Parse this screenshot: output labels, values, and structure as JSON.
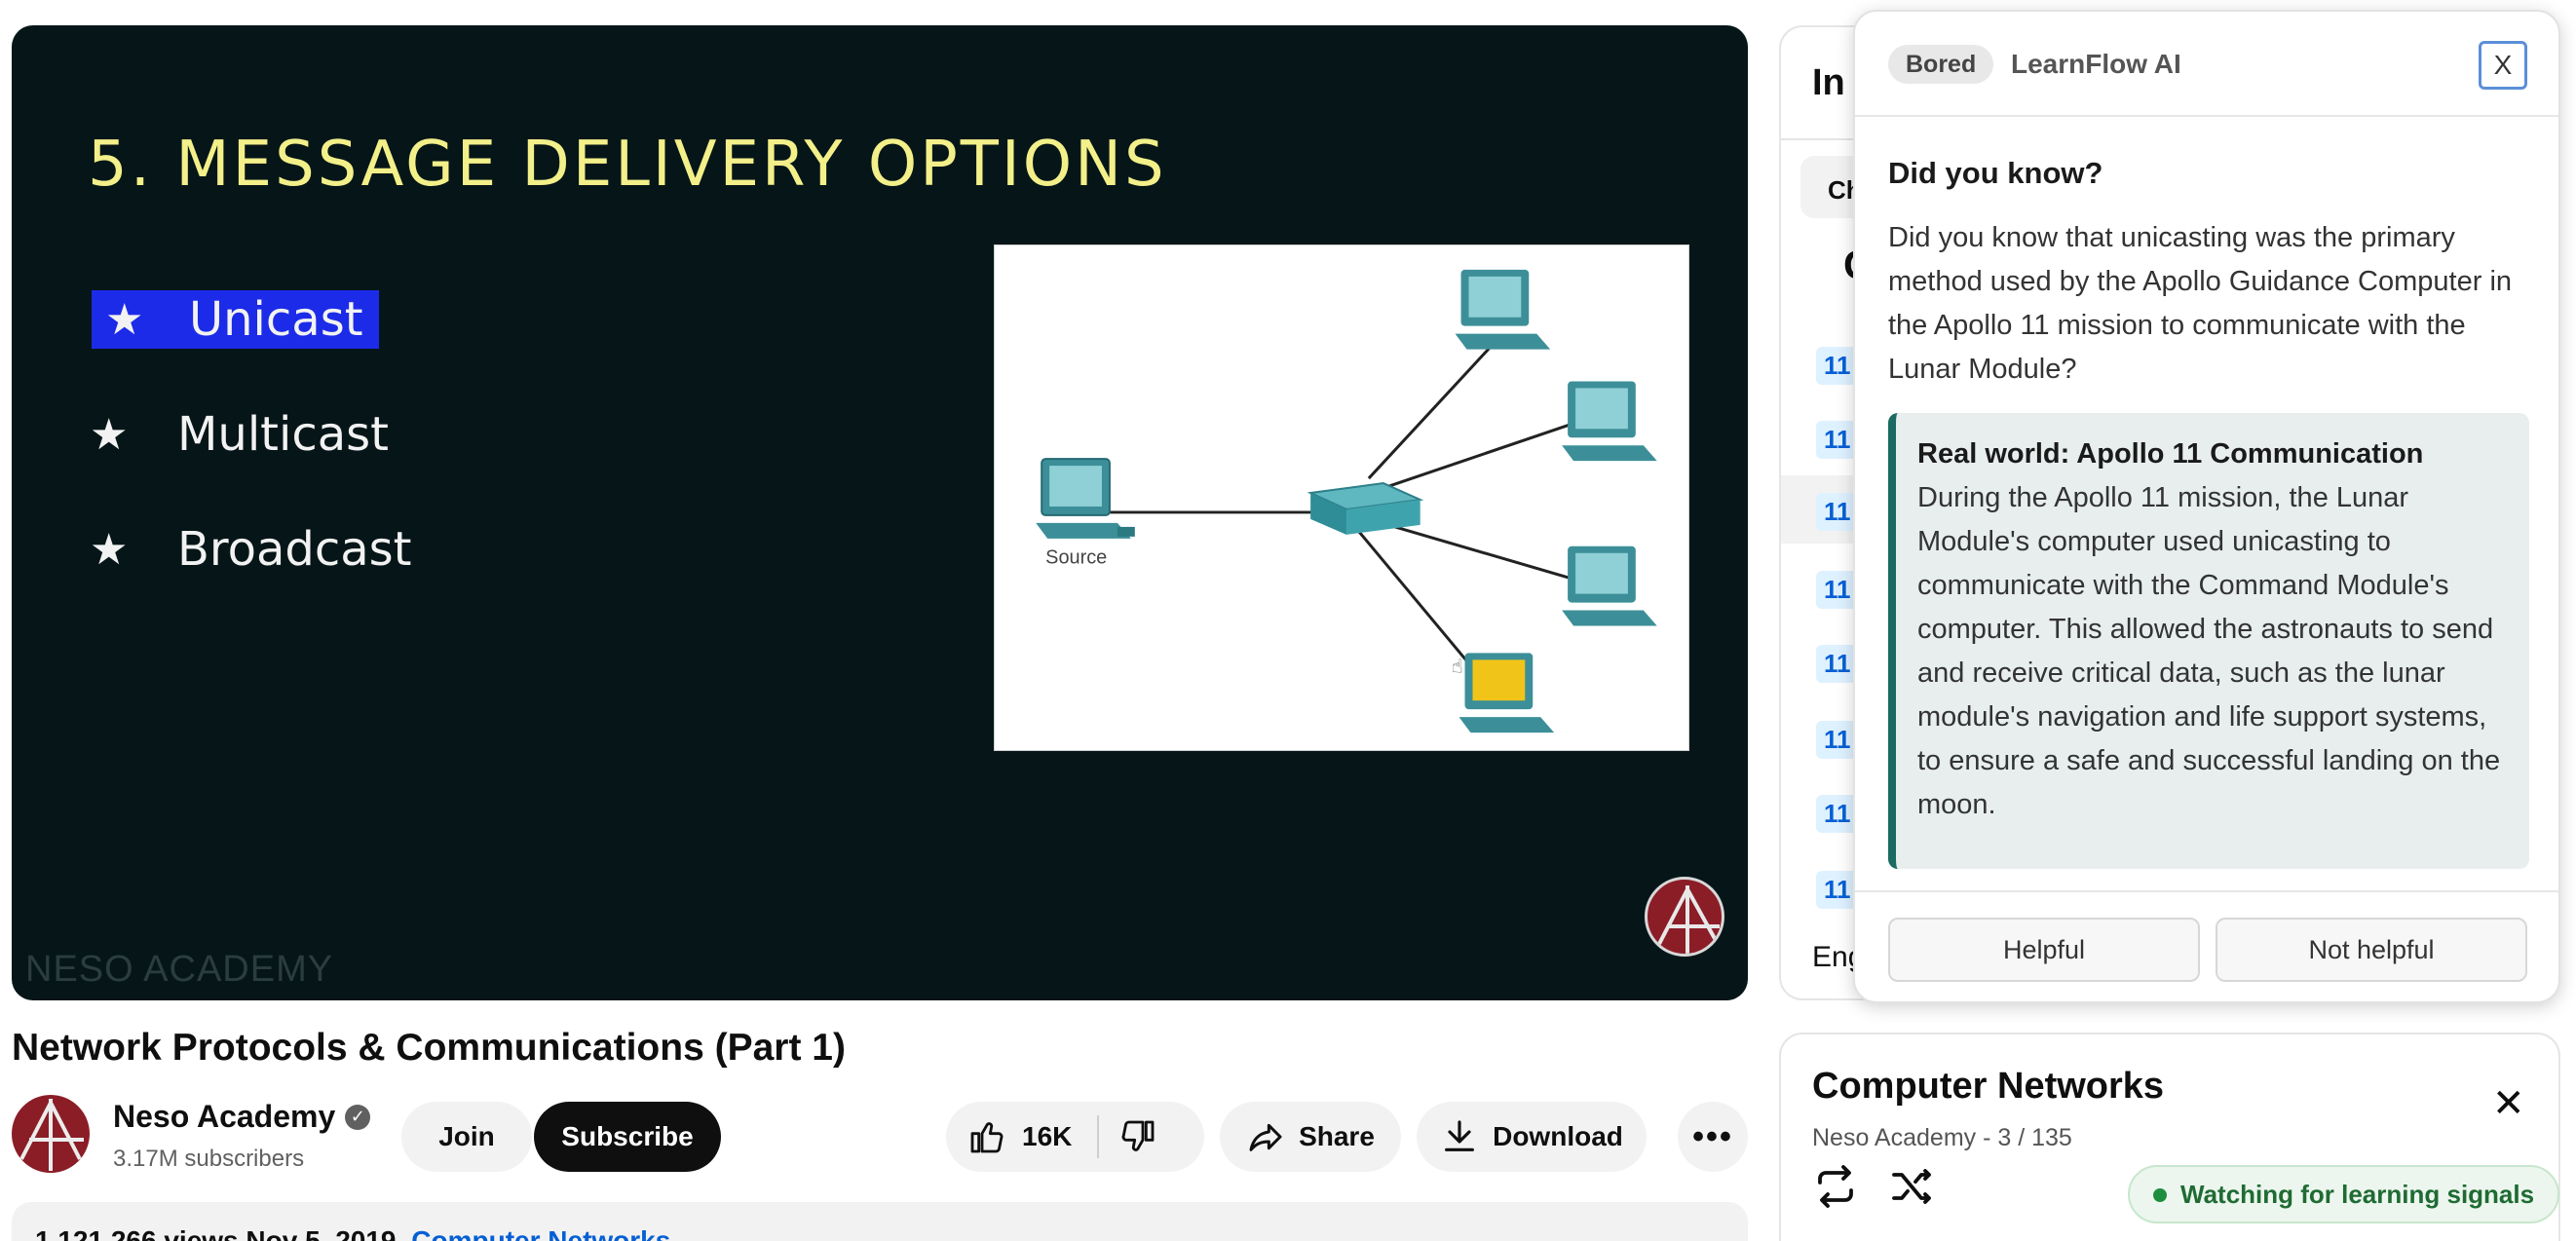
{
  "player": {
    "slide_title": "5. Message Delivery Options",
    "bullets": [
      {
        "label": "Unicast",
        "selected": true
      },
      {
        "label": "Multicast",
        "selected": false
      },
      {
        "label": "Broadcast",
        "selected": false
      }
    ],
    "diagram_source_label": "Source",
    "watermark": "NESO ACADEMY"
  },
  "video": {
    "title": "Network Protocols & Communications (Part 1)",
    "channel_name": "Neso Academy",
    "subscribers": "3.17M subscribers",
    "join_label": "Join",
    "subscribe_label": "Subscribe",
    "likes": "16K",
    "share_label": "Share",
    "download_label": "Download",
    "views_date": "1,121,266 views  Nov 5, 2019",
    "category_link": "Computer Networks"
  },
  "transcript": {
    "title_fragment": "In",
    "chip_fragment": "Ch",
    "fragment_c": "C",
    "timestamp_fragment": "11:",
    "language_fragment": "Eng"
  },
  "popup": {
    "mood_badge": "Bored",
    "brand": "LearnFlow AI",
    "close_label": "X",
    "heading": "Did you know?",
    "question": "Did you know that unicasting was the primary method used by the Apollo Guidance Computer in the Apollo 11 mission to communicate with the Lunar Module?",
    "real_world_title": "Real world: Apollo 11 Communication",
    "real_world_body": "During the Apollo 11 mission, the Lunar Module's computer used unicasting to communicate with the Command Module's computer. This allowed the astronauts to send and receive critical data, such as the lunar module's navigation and life support systems, to ensure a safe and successful landing on the moon.",
    "helpful_label": "Helpful",
    "not_helpful_label": "Not helpful"
  },
  "playlist": {
    "title": "Computer Networks",
    "subtitle": "Neso Academy - 3 / 135",
    "close_label": "✕"
  },
  "status": {
    "signal_label": "Watching for learning signals"
  },
  "colors": {
    "slide_bg": "#061618",
    "slide_title": "#f3f08a",
    "highlight": "#1c2be8",
    "link": "#065fd4",
    "accent_teal": "#1b6b62"
  }
}
